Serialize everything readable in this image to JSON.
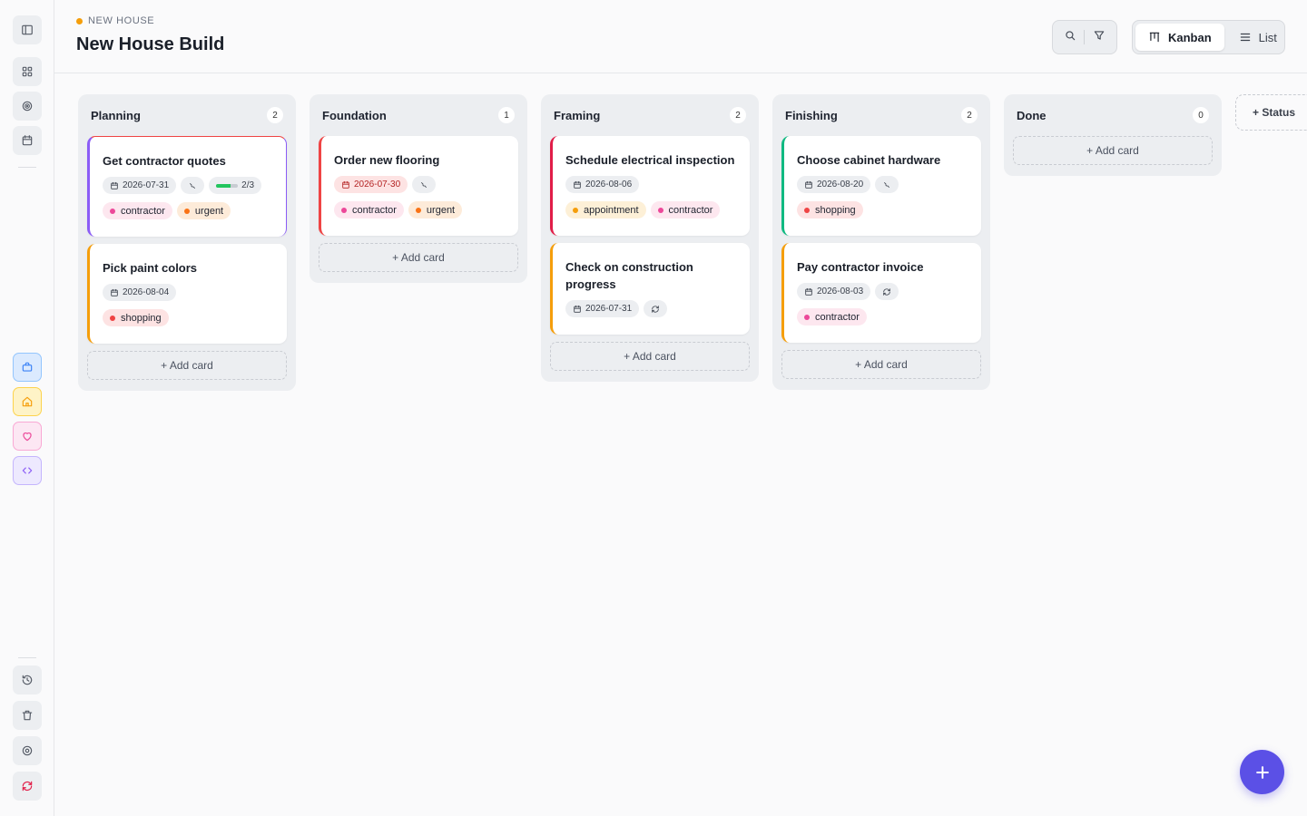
{
  "project": {
    "crumb": "NEW HOUSE",
    "title": "New House Build"
  },
  "colors": {
    "accent": "#5b50e6",
    "crumb_dot": "#f59e0b",
    "progress": "#22c55e"
  },
  "view_switch": {
    "kanban": "Kanban",
    "list": "List",
    "active": "Kanban"
  },
  "sidebar": {
    "top_icons": [
      "sidebar-toggle-icon",
      "grid-icon",
      "target-icon",
      "calendar-icon"
    ],
    "workspace_icons": [
      {
        "name": "briefcase-icon",
        "color": "#3b82f6"
      },
      {
        "name": "home-icon",
        "color": "#f59e0b"
      },
      {
        "name": "heart-icon",
        "color": "#ec4899"
      },
      {
        "name": "code-icon",
        "color": "#8b5cf6"
      }
    ],
    "bottom_icons": [
      "history-icon",
      "trash-icon",
      "settings-icon",
      "sync-icon"
    ]
  },
  "add_card_label": "+ Add card",
  "add_status_label": "+ Status",
  "columns": [
    {
      "title": "Planning",
      "count": "2",
      "cards": [
        {
          "title": "Get contractor quotes",
          "accent": "#8b5cf6",
          "accent_top": "#ef4444",
          "date": "2026-07-31",
          "overdue": false,
          "subtasks": true,
          "progress": {
            "label": "2/3",
            "value": 0.67
          },
          "tags": [
            {
              "label": "contractor",
              "tone": "pink"
            },
            {
              "label": "urgent",
              "tone": "orange"
            }
          ]
        },
        {
          "title": "Pick paint colors",
          "accent": "#f59e0b",
          "date": "2026-08-04",
          "overdue": false,
          "tags": [
            {
              "label": "shopping",
              "tone": "red"
            }
          ]
        }
      ]
    },
    {
      "title": "Foundation",
      "count": "1",
      "cards": [
        {
          "title": "Order new flooring",
          "accent": "#ef4444",
          "date": "2026-07-30",
          "overdue": true,
          "subtasks": true,
          "tags": [
            {
              "label": "contractor",
              "tone": "pink"
            },
            {
              "label": "urgent",
              "tone": "orange"
            }
          ]
        }
      ]
    },
    {
      "title": "Framing",
      "count": "2",
      "cards": [
        {
          "title": "Schedule electrical inspection",
          "accent": "#e11d48",
          "date": "2026-08-06",
          "overdue": false,
          "tags": [
            {
              "label": "appointment",
              "tone": "amber"
            },
            {
              "label": "contractor",
              "tone": "pink"
            }
          ]
        },
        {
          "title": "Check on construction progress",
          "accent": "#f59e0b",
          "date": "2026-07-31",
          "overdue": false,
          "recurring": true,
          "tags": []
        }
      ]
    },
    {
      "title": "Finishing",
      "count": "2",
      "cards": [
        {
          "title": "Choose cabinet hardware",
          "accent": "#10b981",
          "date": "2026-08-20",
          "overdue": false,
          "subtasks": true,
          "tags": [
            {
              "label": "shopping",
              "tone": "red"
            }
          ]
        },
        {
          "title": "Pay contractor invoice",
          "accent": "#f59e0b",
          "date": "2026-08-03",
          "overdue": false,
          "recurring": true,
          "tags": [
            {
              "label": "contractor",
              "tone": "pink"
            }
          ]
        }
      ]
    },
    {
      "title": "Done",
      "count": "0",
      "cards": []
    }
  ]
}
